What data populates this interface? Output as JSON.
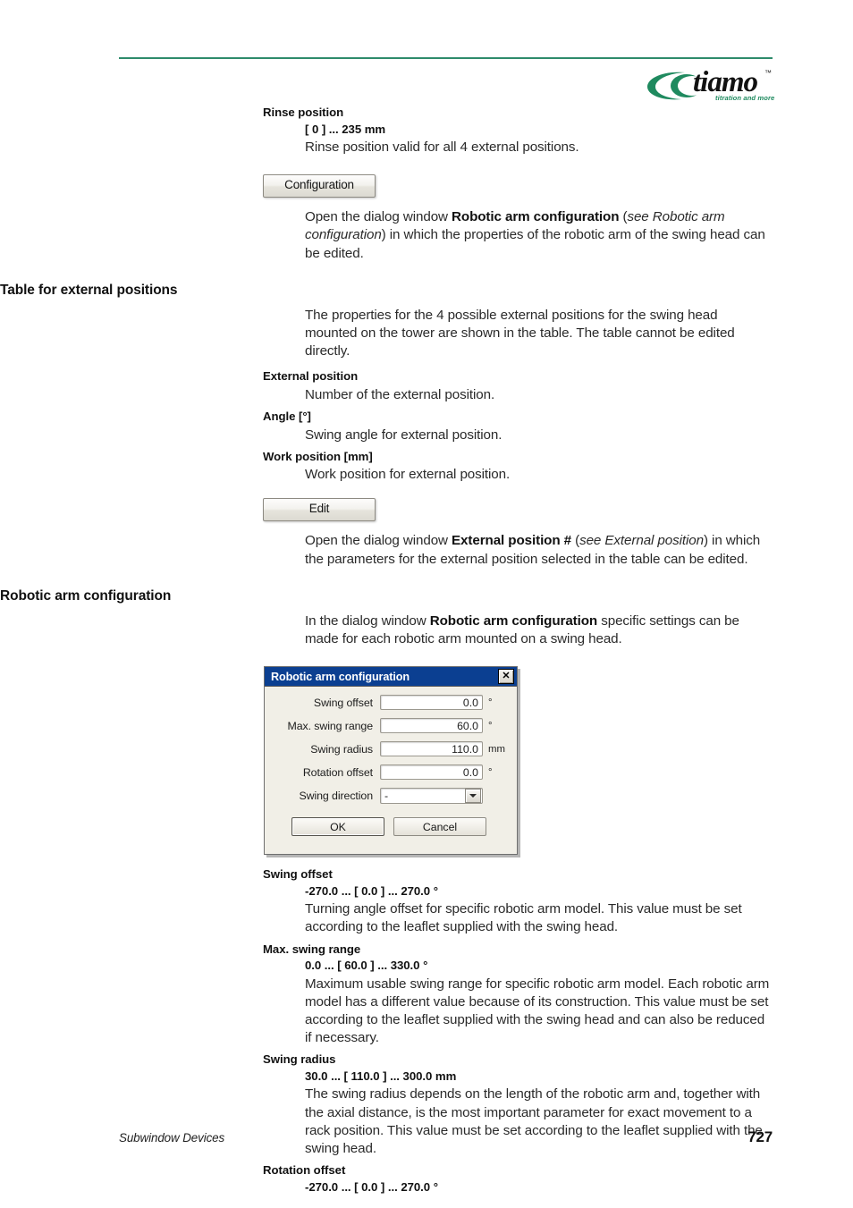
{
  "header": {
    "rule_color": "#2e8b6b",
    "logo": {
      "wordmark": "tiamo",
      "trademark": "™",
      "tagline": "titration and more",
      "swoosh_color": "#1f8a5f"
    }
  },
  "sections": {
    "rinse_position": {
      "param": "Rinse position",
      "range": "[ 0 ] ... 235 mm",
      "body": "Rinse position valid for all 4 external positions."
    },
    "configuration_button": {
      "label": "Configuration",
      "body_pre": "Open the dialog window ",
      "body_bold": "Robotic arm configuration",
      "body_mid": " (",
      "body_italic_see": "see",
      "body_italic_ref": " Robotic arm configuration",
      "body_post": ") in which the properties of the robotic arm of the swing head can be edited."
    },
    "table_external_positions": {
      "heading": "Table for external positions",
      "intro": "The properties for the 4 possible external positions for the swing head mounted on the tower are shown in the table. The table cannot be edited directly.",
      "params": [
        {
          "name": "External position",
          "body": "Number of the external position."
        },
        {
          "name": "Angle [°]",
          "body": "Swing angle for external position."
        },
        {
          "name": "Work position [mm]",
          "body": "Work position for external position."
        }
      ]
    },
    "edit_button": {
      "label": "Edit",
      "body_pre": "Open the dialog window ",
      "body_bold": "External position #",
      "body_mid": " (",
      "body_italic_see": "see",
      "body_italic_ref": " External position",
      "body_post": ") in which the parameters for the external position selected in the table can be edited."
    },
    "robotic_arm_configuration": {
      "heading": "Robotic arm configuration",
      "intro_pre": "In the dialog window ",
      "intro_bold": "Robotic arm configuration",
      "intro_post": " specific settings can be made for each robotic arm mounted on a swing head."
    },
    "parameter_details": [
      {
        "name": "Swing offset",
        "range": "-270.0 ... [ 0.0 ] ... 270.0 °",
        "body": "Turning angle offset for specific robotic arm model. This value must be set according to the leaflet supplied with the swing head."
      },
      {
        "name": "Max. swing range",
        "range": "0.0 ... [ 60.0 ] ... 330.0 °",
        "body": "Maximum usable swing range for specific robotic arm model. Each robotic arm model has a different value because of its construction. This value must be set according to the leaflet supplied with the swing head and can also be reduced if necessary."
      },
      {
        "name": "Swing radius",
        "range": "30.0 ... [ 110.0 ] ... 300.0 mm",
        "body": "The swing radius depends on the length of the robotic arm and, together with the axial distance, is the most important parameter for exact movement to a rack position. This value must be set according to the leaflet supplied with the swing head."
      },
      {
        "name": "Rotation offset",
        "range": "-270.0 ... [ 0.0 ] ... 270.0 °",
        "body": ""
      }
    ]
  },
  "dialog": {
    "title": "Robotic arm configuration",
    "close_label": "✕",
    "titlebar_color": "#0b3f91",
    "fields": [
      {
        "label": "Swing offset",
        "value": "0.0",
        "unit": "°"
      },
      {
        "label": "Max. swing range",
        "value": "60.0",
        "unit": "°"
      },
      {
        "label": "Swing radius",
        "value": "110.0",
        "unit": "mm"
      },
      {
        "label": "Rotation offset",
        "value": "0.0",
        "unit": "°"
      }
    ],
    "select": {
      "label": "Swing direction",
      "value": "-"
    },
    "buttons": {
      "ok": "OK",
      "cancel": "Cancel"
    }
  },
  "footer": {
    "left": "Subwindow Devices",
    "page": "727"
  }
}
